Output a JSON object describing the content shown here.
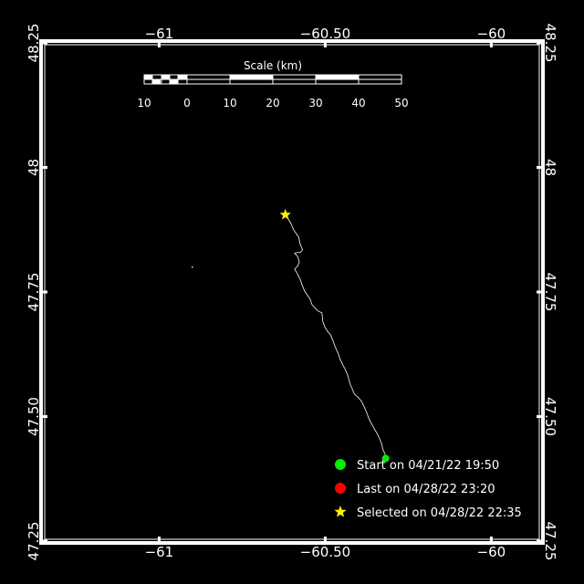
{
  "map": {
    "lon_range": [
      -61.35,
      -59.85
    ],
    "lat_range": [
      47.25,
      48.25
    ],
    "lon_ticks": [
      {
        "value": -61,
        "label": "−61"
      },
      {
        "value": -60.5,
        "label": "−60.50"
      },
      {
        "value": -60,
        "label": "−60"
      }
    ],
    "lat_ticks": [
      {
        "value": 47.25,
        "label": "47.25"
      },
      {
        "value": 47.5,
        "label": "47.50"
      },
      {
        "value": 47.75,
        "label": "47.75"
      },
      {
        "value": 48,
        "label": "48"
      },
      {
        "value": 48.25,
        "label": "48.25"
      }
    ],
    "colors": {
      "background": "#000000",
      "frame": "#ffffff",
      "track": "#ffffff",
      "start": "#00ee00",
      "last": "#ff0000",
      "selected": "#ffee00"
    }
  },
  "scale_bar": {
    "title": "Scale (km)",
    "labels": [
      "10",
      "0",
      "10",
      "20",
      "30",
      "40",
      "50"
    ]
  },
  "legend": {
    "start": "Start on 04/21/22 19:50",
    "last": "Last on 04/28/22 23:20",
    "selected": "Selected on 04/28/22 22:35",
    "start_icon": "green-circle",
    "last_icon": "red-circle",
    "selected_icon": "yellow-star"
  },
  "track": {
    "points": [
      [
        -60.62,
        47.905
      ],
      [
        -60.605,
        47.89
      ],
      [
        -60.595,
        47.875
      ],
      [
        -60.588,
        47.868
      ],
      [
        -60.58,
        47.86
      ],
      [
        -60.575,
        47.845
      ],
      [
        -60.568,
        47.835
      ],
      [
        -60.574,
        47.83
      ],
      [
        -60.592,
        47.828
      ],
      [
        -60.582,
        47.82
      ],
      [
        -60.578,
        47.81
      ],
      [
        -60.583,
        47.802
      ],
      [
        -60.592,
        47.796
      ],
      [
        -60.585,
        47.788
      ],
      [
        -60.575,
        47.775
      ],
      [
        -60.57,
        47.765
      ],
      [
        -60.562,
        47.752
      ],
      [
        -60.552,
        47.742
      ],
      [
        -60.545,
        47.735
      ],
      [
        -60.54,
        47.725
      ],
      [
        -60.53,
        47.717
      ],
      [
        -60.522,
        47.712
      ],
      [
        -60.51,
        47.708
      ],
      [
        -60.507,
        47.69
      ],
      [
        -60.5,
        47.678
      ],
      [
        -60.493,
        47.671
      ],
      [
        -60.485,
        47.665
      ],
      [
        -60.478,
        47.655
      ],
      [
        -60.47,
        47.64
      ],
      [
        -60.46,
        47.625
      ],
      [
        -60.455,
        47.615
      ],
      [
        -60.448,
        47.605
      ],
      [
        -60.44,
        47.595
      ],
      [
        -60.432,
        47.582
      ],
      [
        -60.425,
        47.565
      ],
      [
        -60.418,
        47.555
      ],
      [
        -60.412,
        47.545
      ],
      [
        -60.4,
        47.538
      ],
      [
        -60.39,
        47.53
      ],
      [
        -60.383,
        47.52
      ],
      [
        -60.375,
        47.508
      ],
      [
        -60.368,
        47.495
      ],
      [
        -60.36,
        47.485
      ],
      [
        -60.352,
        47.475
      ],
      [
        -60.343,
        47.465
      ],
      [
        -60.336,
        47.455
      ],
      [
        -60.33,
        47.445
      ],
      [
        -60.327,
        47.435
      ],
      [
        -60.32,
        47.425
      ],
      [
        -60.318,
        47.416
      ]
    ],
    "start": [
      -60.318,
      47.416
    ],
    "selected": [
      -60.62,
      47.905
    ],
    "stray_point": [
      -60.9,
      47.8
    ]
  }
}
